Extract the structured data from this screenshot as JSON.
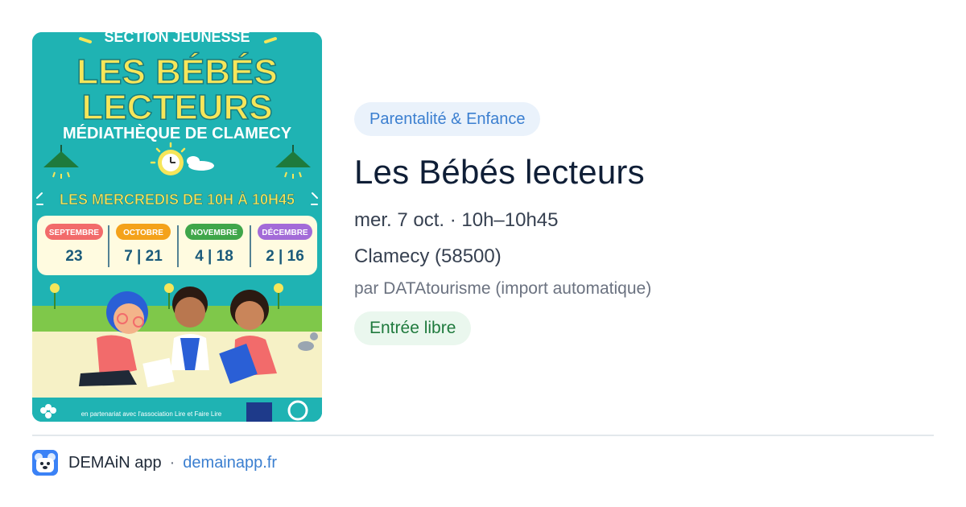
{
  "poster": {
    "section": "SECTION JEUNESSE",
    "title_line1": "LES BÉBÉS",
    "title_line2": "LECTEURS",
    "venue": "MÉDIATHÈQUE DE CLAMECY",
    "schedule": "LES MERCREDIS DE 10H À 10H45",
    "months": [
      {
        "name": "SEPTEMBRE",
        "days": "23",
        "color": "#f26b6b"
      },
      {
        "name": "OCTOBRE",
        "days": "7 | 21",
        "color": "#f4a21a"
      },
      {
        "name": "NOVEMBRE",
        "days": "4 | 18",
        "color": "#3fa64a"
      },
      {
        "name": "DÉCEMBRE",
        "days": "2 | 16",
        "color": "#a36bd8"
      }
    ],
    "partner": "en partenariat avec l'association Lire et Faire Lire",
    "colors": {
      "background": "#1fb3b3",
      "title": "#f6e65a",
      "grass": "#7fc84a",
      "ground": "#f6f1c6"
    }
  },
  "event": {
    "category": "Parentalité & Enfance",
    "title": "Les Bébés lecteurs",
    "datetime": "mer. 7 oct. · 10h–10h45",
    "location": "Clamecy (58500)",
    "source": "par DATAtourisme (import automatique)",
    "price": "Entrée libre"
  },
  "footer": {
    "app_name": "DEMAiN app",
    "separator": "·",
    "link": "demainapp.fr",
    "logo_icon": "bear-face-icon"
  }
}
